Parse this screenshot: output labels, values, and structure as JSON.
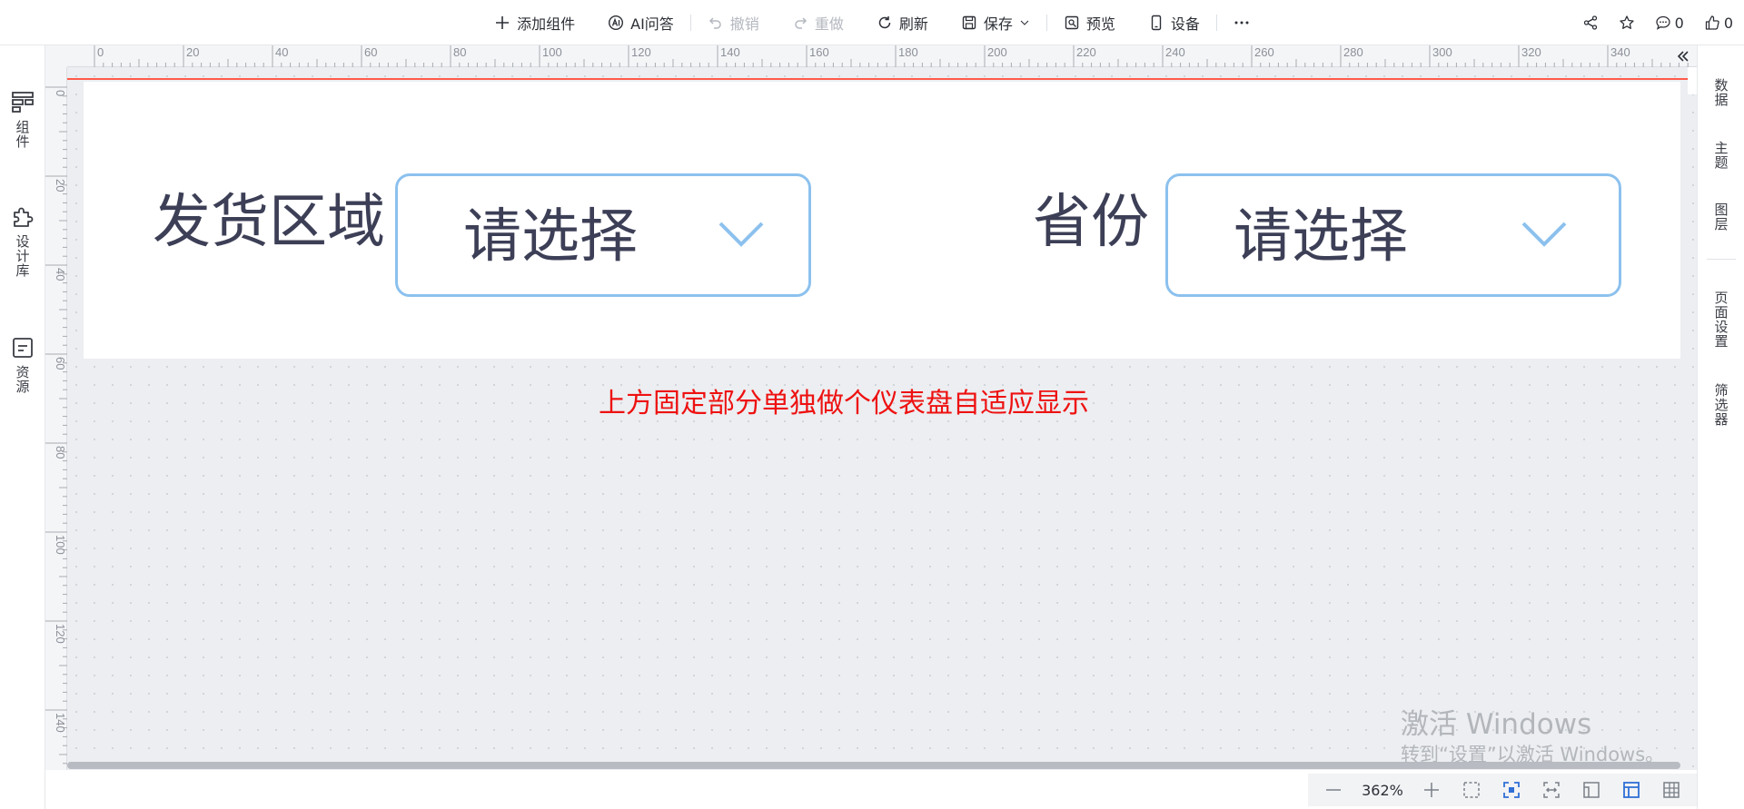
{
  "toolbar": {
    "add_component": "添加组件",
    "ai_qa": "AI问答",
    "undo": "撤销",
    "redo": "重做",
    "refresh": "刷新",
    "save": "保存",
    "preview": "预览",
    "device": "设备",
    "comment_count": "0",
    "like_count": "0"
  },
  "left_sidebar": {
    "components": "组件",
    "design_library": "设计库",
    "resources": "资源"
  },
  "right_sidebar": {
    "data": "数据",
    "theme": "主题",
    "layers": "图层",
    "page_settings": "页面设置",
    "filter": "筛选器"
  },
  "ruler": {
    "top_labels": [
      "0",
      "20",
      "40",
      "60",
      "80",
      "100",
      "120",
      "140",
      "160",
      "180",
      "200",
      "220",
      "240",
      "260",
      "280",
      "300",
      "320",
      "340"
    ],
    "left_labels": [
      "0",
      "20",
      "40",
      "60",
      "80",
      "100",
      "120",
      "140"
    ]
  },
  "canvas": {
    "filters": [
      {
        "label": "发货区域",
        "placeholder": "请选择"
      },
      {
        "label": "省份",
        "placeholder": "请选择"
      }
    ],
    "annotation": "上方固定部分单独做个仪表盘自适应显示"
  },
  "watermark": {
    "line1": "激活 Windows",
    "line2": "转到“设置”以激活 Windows。"
  },
  "bottom": {
    "zoom": "362%"
  },
  "colors": {
    "accent": "#8cc1ee",
    "annotation": "#ee1111",
    "guide": "#ff5a4a",
    "active_icon": "#2f6fd6"
  }
}
